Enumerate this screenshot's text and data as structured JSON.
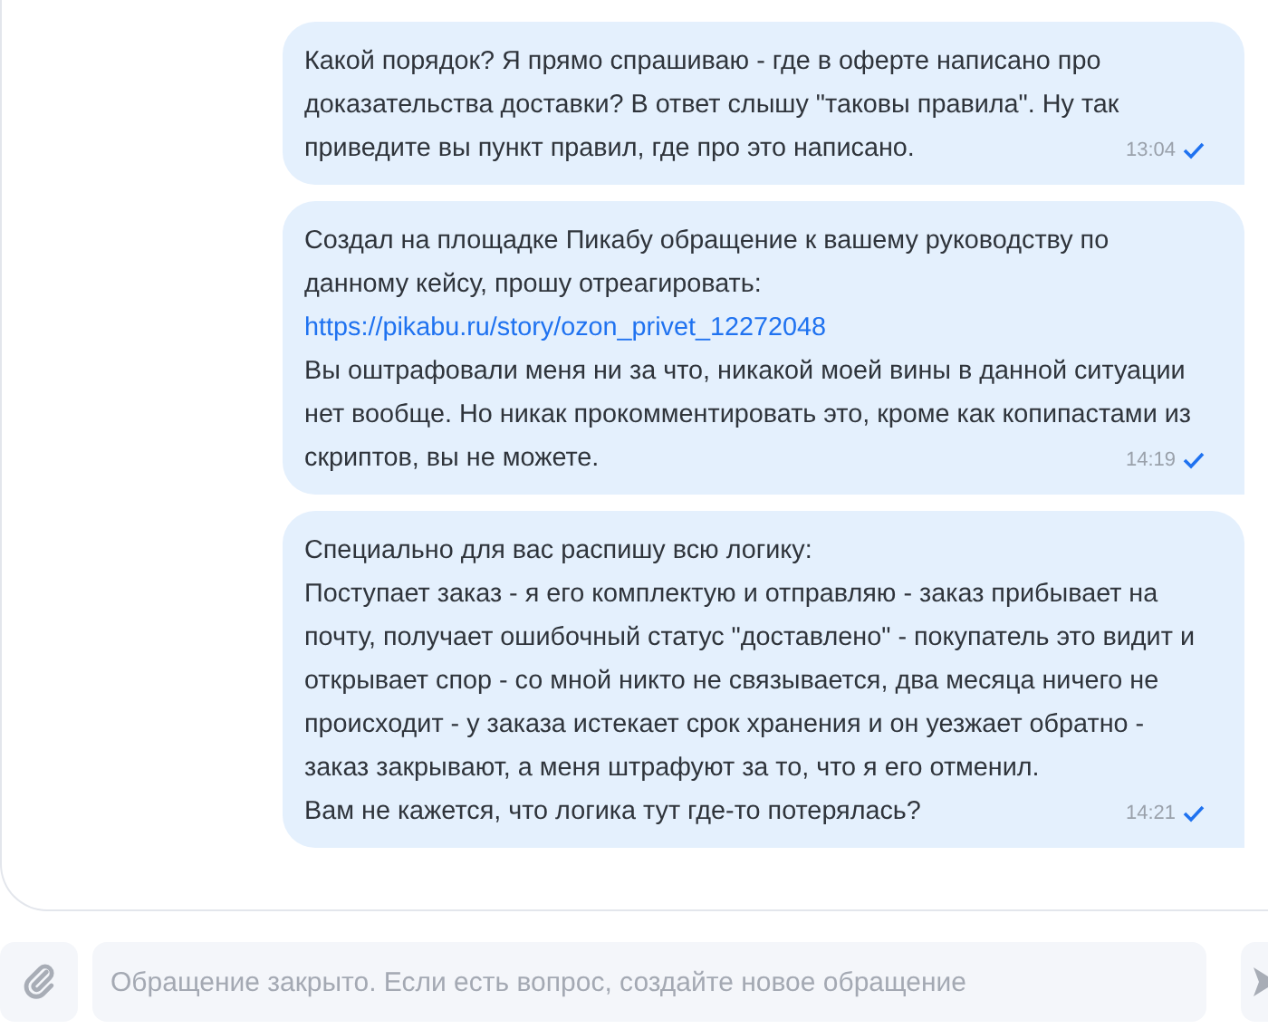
{
  "messages": [
    {
      "parts": [
        {
          "kind": "text",
          "text": "Какой порядок? Я прямо спрашиваю - где в оферте написано про доказательства доставки? В ответ слышу \"таковы правила\". Ну так приведите вы пункт правил, где про это написано."
        }
      ],
      "time": "13:04",
      "read": true
    },
    {
      "parts": [
        {
          "kind": "text",
          "text": "Создал на площадке Пикабу обращение к вашему руководству по данному кейсу, прошу отреагировать:"
        },
        {
          "kind": "link",
          "text": "https://pikabu.ru/story/ozon_privet_12272048"
        },
        {
          "kind": "text",
          "text": "Вы оштрафовали меня ни за что, никакой моей вины в данной ситуации нет вообще. Но никак прокомментировать это, кроме как копипастами из скриптов, вы не можете."
        }
      ],
      "time": "14:19",
      "read": true
    },
    {
      "parts": [
        {
          "kind": "text",
          "text": "Специально для вас распишу всю логику:"
        },
        {
          "kind": "text",
          "text": "Поступает заказ - я его комплектую и отправляю - заказ прибывает на почту, получает ошибочный статус \"доставлено\" - покупатель это видит и открывает спор - со мной никто не связывается, два месяца ничего не происходит - у заказа истекает срок хранения и он уезжает обратно - заказ закрывают, а меня штрафуют за то, что я его отменил."
        },
        {
          "kind": "text",
          "text": "Вам не кажется, что логика тут где-то потерялась?"
        }
      ],
      "time": "14:21",
      "read": true
    }
  ],
  "composer": {
    "placeholder": "Обращение закрыто. Если есть вопрос, создайте новое обращение",
    "disabled": true
  }
}
